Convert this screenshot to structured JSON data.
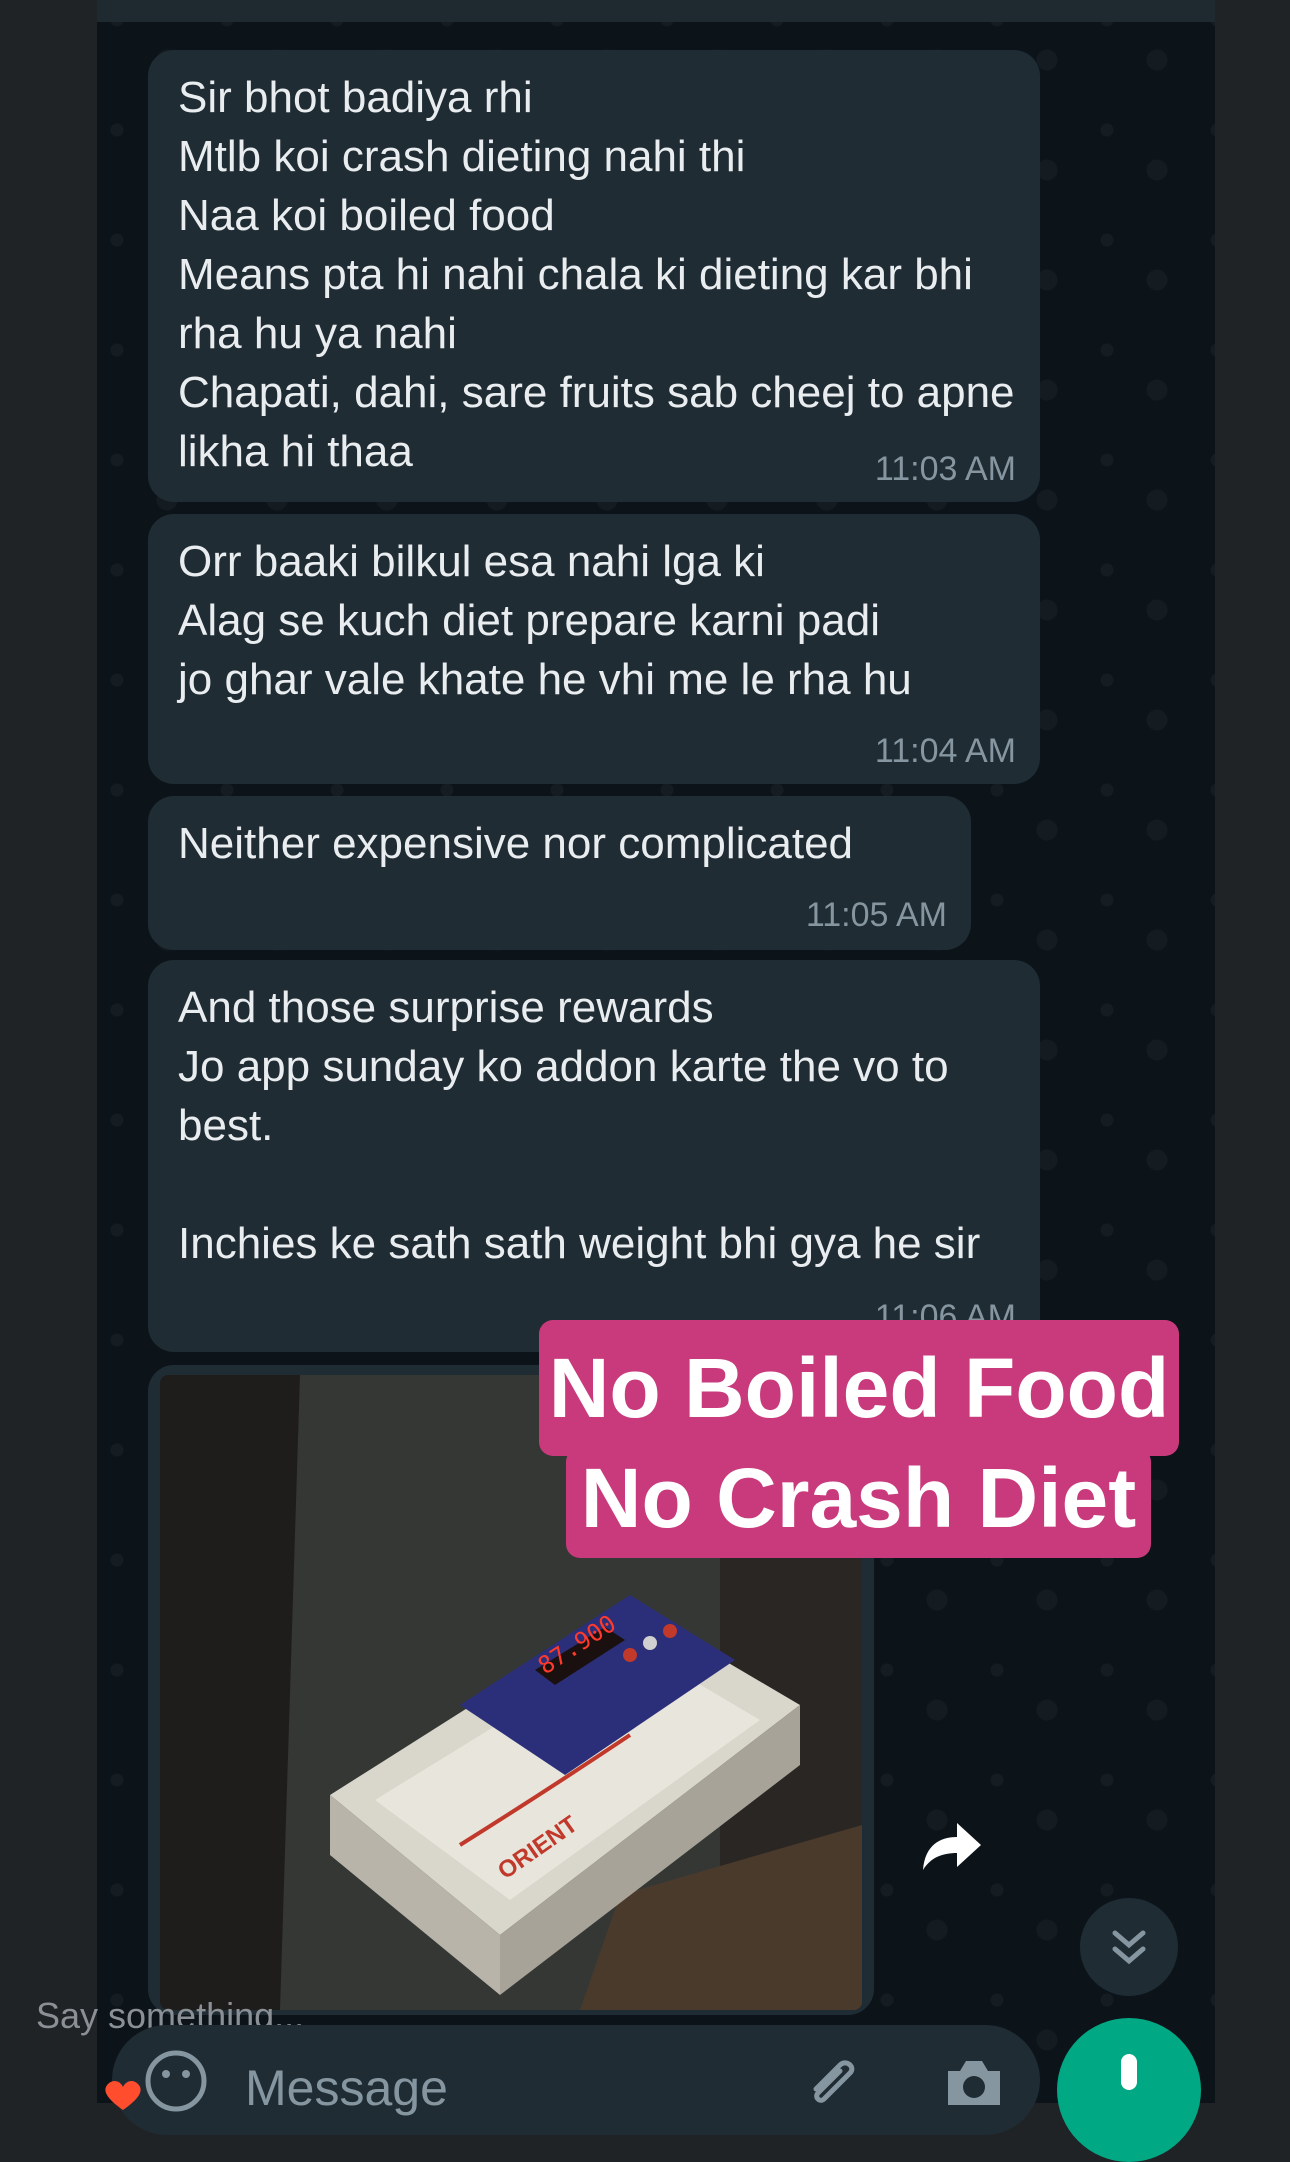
{
  "messages": [
    {
      "text": "Sir bhot badiya rhi\nMtlb koi crash dieting nahi thi\nNaa koi boiled food\nMeans pta hi nahi chala ki dieting kar bhi rha hu ya nahi\nChapati, dahi, sare fruits  sab cheej to apne likha hi thaa",
      "time": "11:03 AM"
    },
    {
      "text": "Orr baaki bilkul esa nahi lga ki\nAlag se kuch diet prepare karni padi\njo ghar vale khate he vhi me le rha hu",
      "time": "11:04 AM"
    },
    {
      "text": "Neither expensive nor complicated",
      "time": "11:05 AM"
    },
    {
      "text": "And those surprise rewards\nJo app sunday ko addon karte the vo to best.\n\nInchies ke sath sath weight bhi gya he sir",
      "time": "11:06 AM"
    }
  ],
  "photo": {
    "scale_brand": "ORIENT",
    "scale_reading": "87.900"
  },
  "caption": {
    "line1": "No Boiled Food",
    "line2": "No Crash Diet"
  },
  "overlay": {
    "prompt": "Say something..."
  },
  "input": {
    "placeholder": "Message"
  },
  "colors": {
    "chat_bg": "#0c141a",
    "bubble": "#1f2c34",
    "caption_bg": "#c83a7c",
    "accent": "#00a884"
  }
}
